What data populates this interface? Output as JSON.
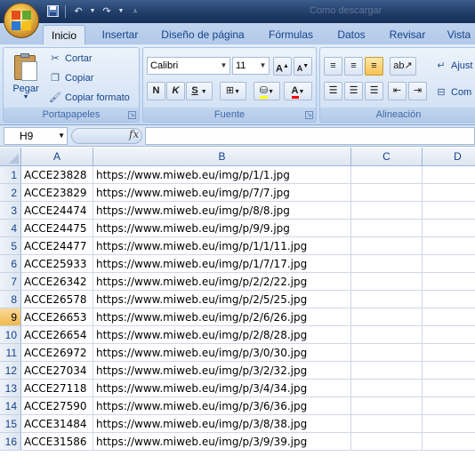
{
  "window": {
    "title": "Como descargar"
  },
  "quick_access": {
    "save_icon": "save-icon",
    "undo_icon": "undo-icon",
    "redo_icon": "redo-icon"
  },
  "tabs": [
    {
      "label": "Inicio",
      "active": true
    },
    {
      "label": "Insertar"
    },
    {
      "label": "Diseño de página"
    },
    {
      "label": "Fórmulas"
    },
    {
      "label": "Datos"
    },
    {
      "label": "Revisar"
    },
    {
      "label": "Vista"
    }
  ],
  "clipboard_group": {
    "label": "Portapapeles",
    "paste_label": "Pegar",
    "cut_label": "Cortar",
    "copy_label": "Copiar",
    "format_painter_label": "Copiar formato"
  },
  "font_group": {
    "label": "Fuente",
    "font_name": "Calibri",
    "font_size": "11",
    "grow_label": "A",
    "shrink_label": "A",
    "bold_label": "N",
    "italic_label": "K",
    "underline_label": "S",
    "font_color_label": "A",
    "highlight_color": "#ffff00",
    "font_color": "#ff0000"
  },
  "alignment_group": {
    "label": "Alineación",
    "wrap_label": "Ajust",
    "merge_label": "Com"
  },
  "formula_bar": {
    "name_box": "H9",
    "fx_label": "fx",
    "formula": ""
  },
  "sheet": {
    "columns": [
      "A",
      "B",
      "C",
      "D"
    ],
    "selected_row": 9,
    "rows": [
      {
        "num": "1",
        "a": "ACCE23828",
        "b": "https://www.miweb.eu/img/p/1/1.jpg"
      },
      {
        "num": "2",
        "a": "ACCE23829",
        "b": "https://www.miweb.eu/img/p/7/7.jpg"
      },
      {
        "num": "3",
        "a": "ACCE24474",
        "b": "https://www.miweb.eu/img/p/8/8.jpg"
      },
      {
        "num": "4",
        "a": "ACCE24475",
        "b": "https://www.miweb.eu/img/p/9/9.jpg"
      },
      {
        "num": "5",
        "a": "ACCE24477",
        "b": "https://www.miweb.eu/img/p/1/1/11.jpg"
      },
      {
        "num": "6",
        "a": "ACCE25933",
        "b": "https://www.miweb.eu/img/p/1/7/17.jpg"
      },
      {
        "num": "7",
        "a": "ACCE26342",
        "b": "https://www.miweb.eu/img/p/2/2/22.jpg"
      },
      {
        "num": "8",
        "a": "ACCE26578",
        "b": "https://www.miweb.eu/img/p/2/5/25.jpg"
      },
      {
        "num": "9",
        "a": "ACCE26653",
        "b": "https://www.miweb.eu/img/p/2/6/26.jpg"
      },
      {
        "num": "10",
        "a": "ACCE26654",
        "b": "https://www.miweb.eu/img/p/2/8/28.jpg"
      },
      {
        "num": "11",
        "a": "ACCE26972",
        "b": "https://www.miweb.eu/img/p/3/0/30.jpg"
      },
      {
        "num": "12",
        "a": "ACCE27034",
        "b": "https://www.miweb.eu/img/p/3/2/32.jpg"
      },
      {
        "num": "13",
        "a": "ACCE27118",
        "b": "https://www.miweb.eu/img/p/3/4/34.jpg"
      },
      {
        "num": "14",
        "a": "ACCE27590",
        "b": "https://www.miweb.eu/img/p/3/6/36.jpg"
      },
      {
        "num": "15",
        "a": "ACCE31484",
        "b": "https://www.miweb.eu/img/p/3/8/38.jpg"
      },
      {
        "num": "16",
        "a": "ACCE31586",
        "b": "https://www.miweb.eu/img/p/3/9/39.jpg"
      }
    ]
  }
}
